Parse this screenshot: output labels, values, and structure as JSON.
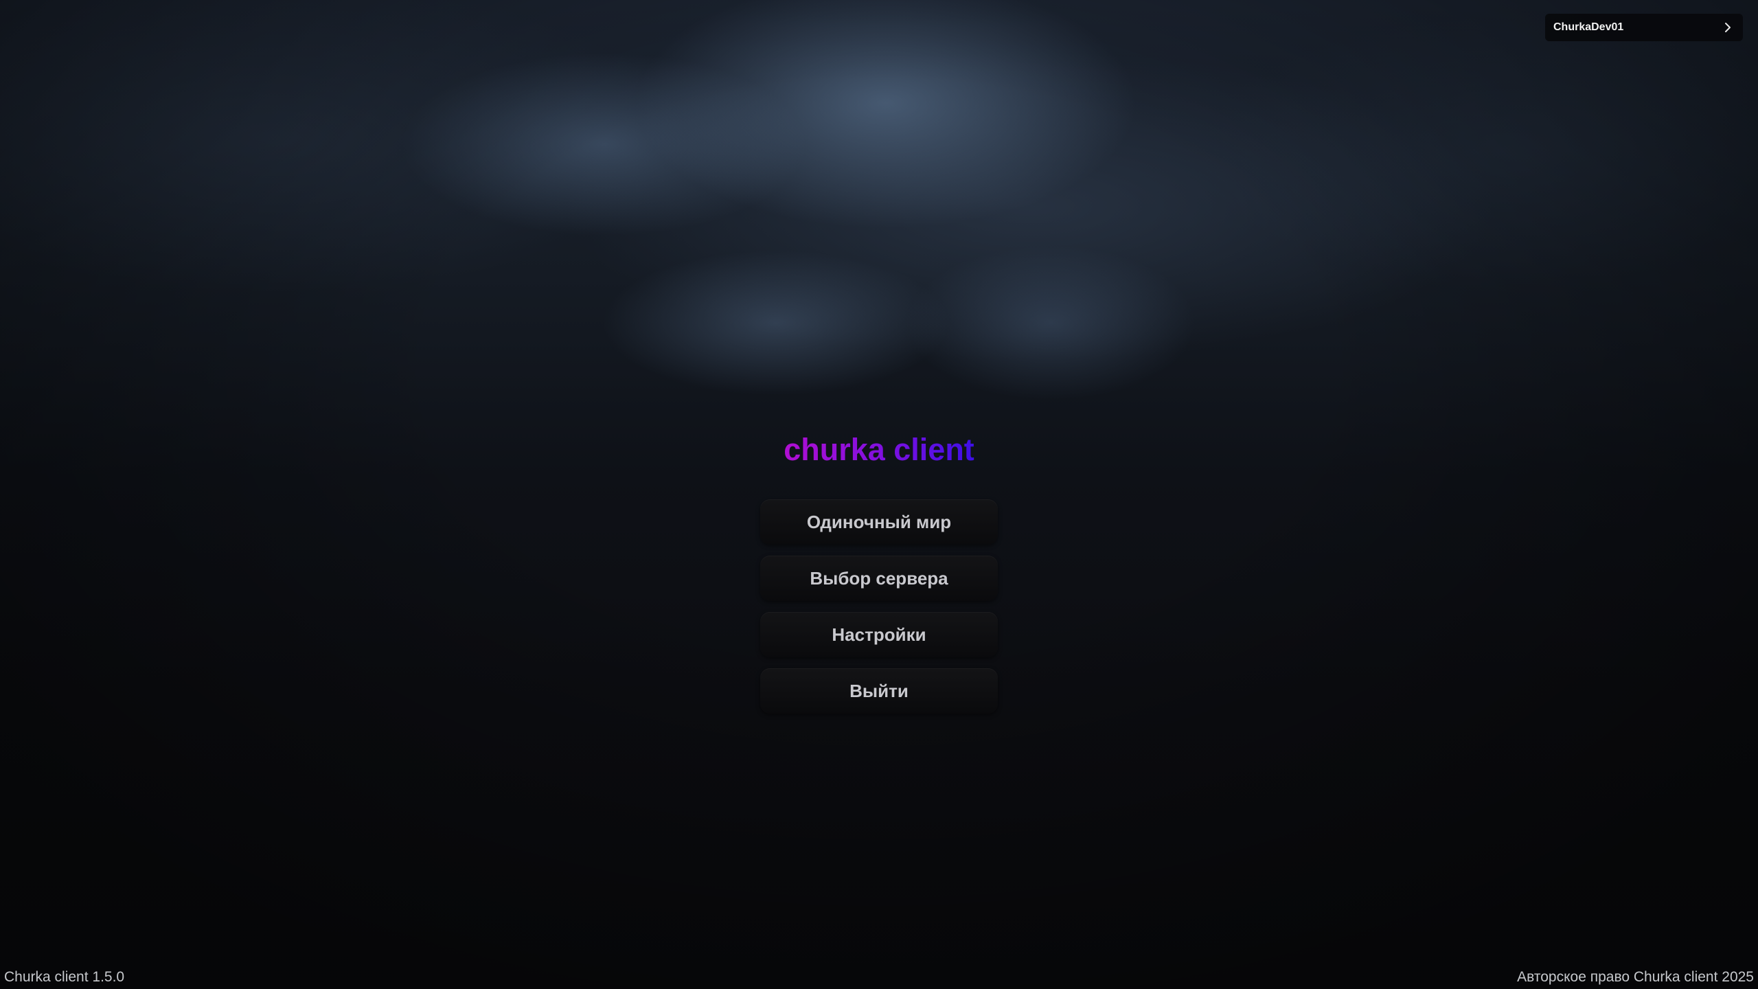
{
  "app": {
    "title": "churka client",
    "version_label": "Churka client 1.5.0",
    "copyright": "Авторское право Churka client 2025"
  },
  "account": {
    "username": "ChurkaDev01",
    "icon": "chevron-right-icon"
  },
  "menu": {
    "items": [
      {
        "label": "Одиночный мир"
      },
      {
        "label": "Выбор сервера"
      },
      {
        "label": "Настройки"
      },
      {
        "label": "Выйти"
      }
    ]
  },
  "colors": {
    "title_gradient_start": "#b10fd2",
    "title_gradient_end": "#3d0fe6",
    "button_text": "#c9c9ce",
    "button_bg": "#0f0f11"
  }
}
